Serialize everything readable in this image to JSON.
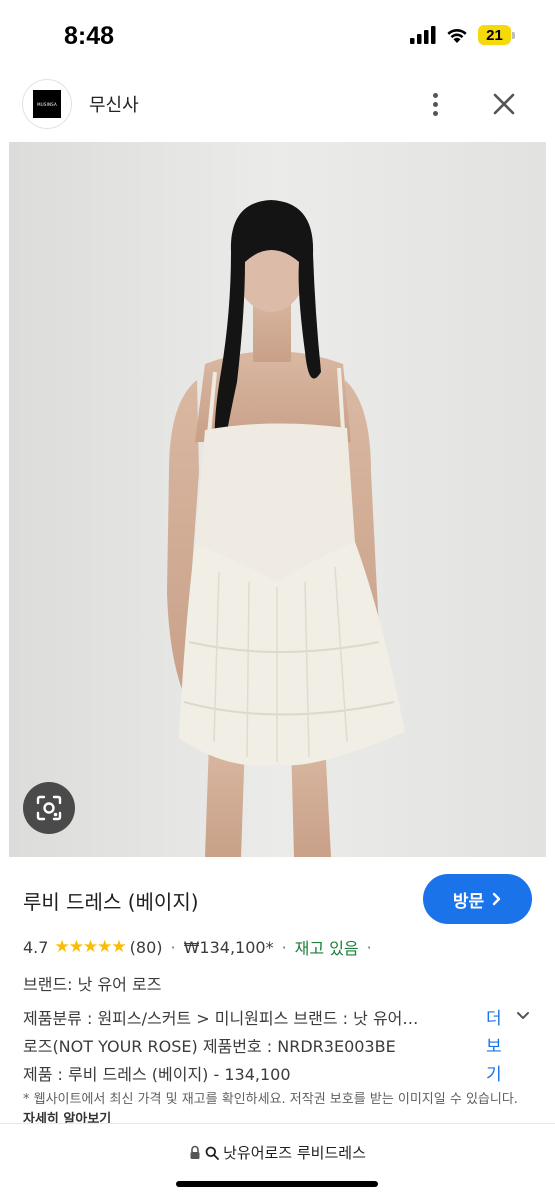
{
  "status_bar": {
    "time": "8:48",
    "battery": "21",
    "icons": [
      "signal-icon",
      "wifi-icon",
      "battery-icon"
    ]
  },
  "header": {
    "logo_text": "MUSINSA",
    "title": "무신사",
    "icons": [
      "more-vert-icon",
      "close-icon"
    ]
  },
  "hero": {
    "icons": [
      "lens-search-icon"
    ]
  },
  "product": {
    "title": "루비 드레스 (베이지)",
    "visit_label": "방문",
    "rating": "4.7",
    "review_count": "(80)",
    "price": "₩134,100*",
    "stock": "재고 있음",
    "brand": "브랜드: 낫 유어 로즈",
    "description": [
      "제품분류 : 원피스/스커트 > 미니원피스 브랜드 : 낫 유어…",
      "로즈(NOT YOUR ROSE) 제품번호 : NRDR3E003BE",
      "제품 : 루비 드레스 (베이지) - 134,100"
    ],
    "more_label": "더보기",
    "note": "* 웹사이트에서 최신 가격 및 재고를 확인하세요. 저작권 보호를 받는 이미지일 수 있습니다.",
    "note_link": "자세히 알아보기"
  },
  "bottom": {
    "url_text": "낫유어로즈 루비드레스",
    "icons": [
      "lock-icon",
      "search-icon"
    ]
  },
  "colors": {
    "accent": "#1a73e8",
    "star": "#fbbc04",
    "stock_green": "#188038",
    "battery_yellow": "#f5d90a"
  }
}
